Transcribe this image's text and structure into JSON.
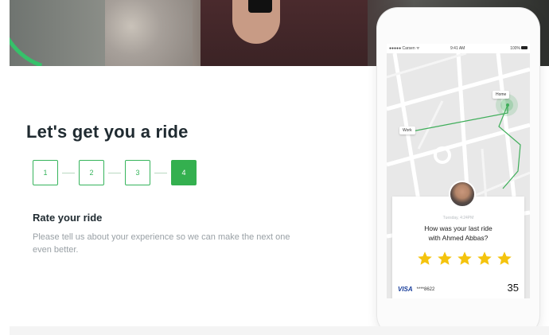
{
  "headline": "Let's get you a ride",
  "steps": [
    "1",
    "2",
    "3",
    "4"
  ],
  "active_step": 4,
  "section": {
    "title": "Rate your ride",
    "body": "Please tell us about your experience so we can make the next one even better."
  },
  "phone": {
    "status": {
      "carrier": "●●●●● Carsen ᯤ",
      "time": "9:41 AM",
      "battery": "100%"
    },
    "map": {
      "home_label": "Home",
      "work_label": "Work"
    },
    "rating_card": {
      "timestamp": "Tuesday, 4:24PM",
      "question_line1": "How was your last ride",
      "question_line2": "with Ahmed Abbas?",
      "stars": 5,
      "star_color": "#f4c30d",
      "payment_brand": "VISA",
      "card_number": "****8622",
      "fare": "35"
    }
  },
  "colors": {
    "accent": "#34b04f",
    "route": "#3fae5a"
  }
}
